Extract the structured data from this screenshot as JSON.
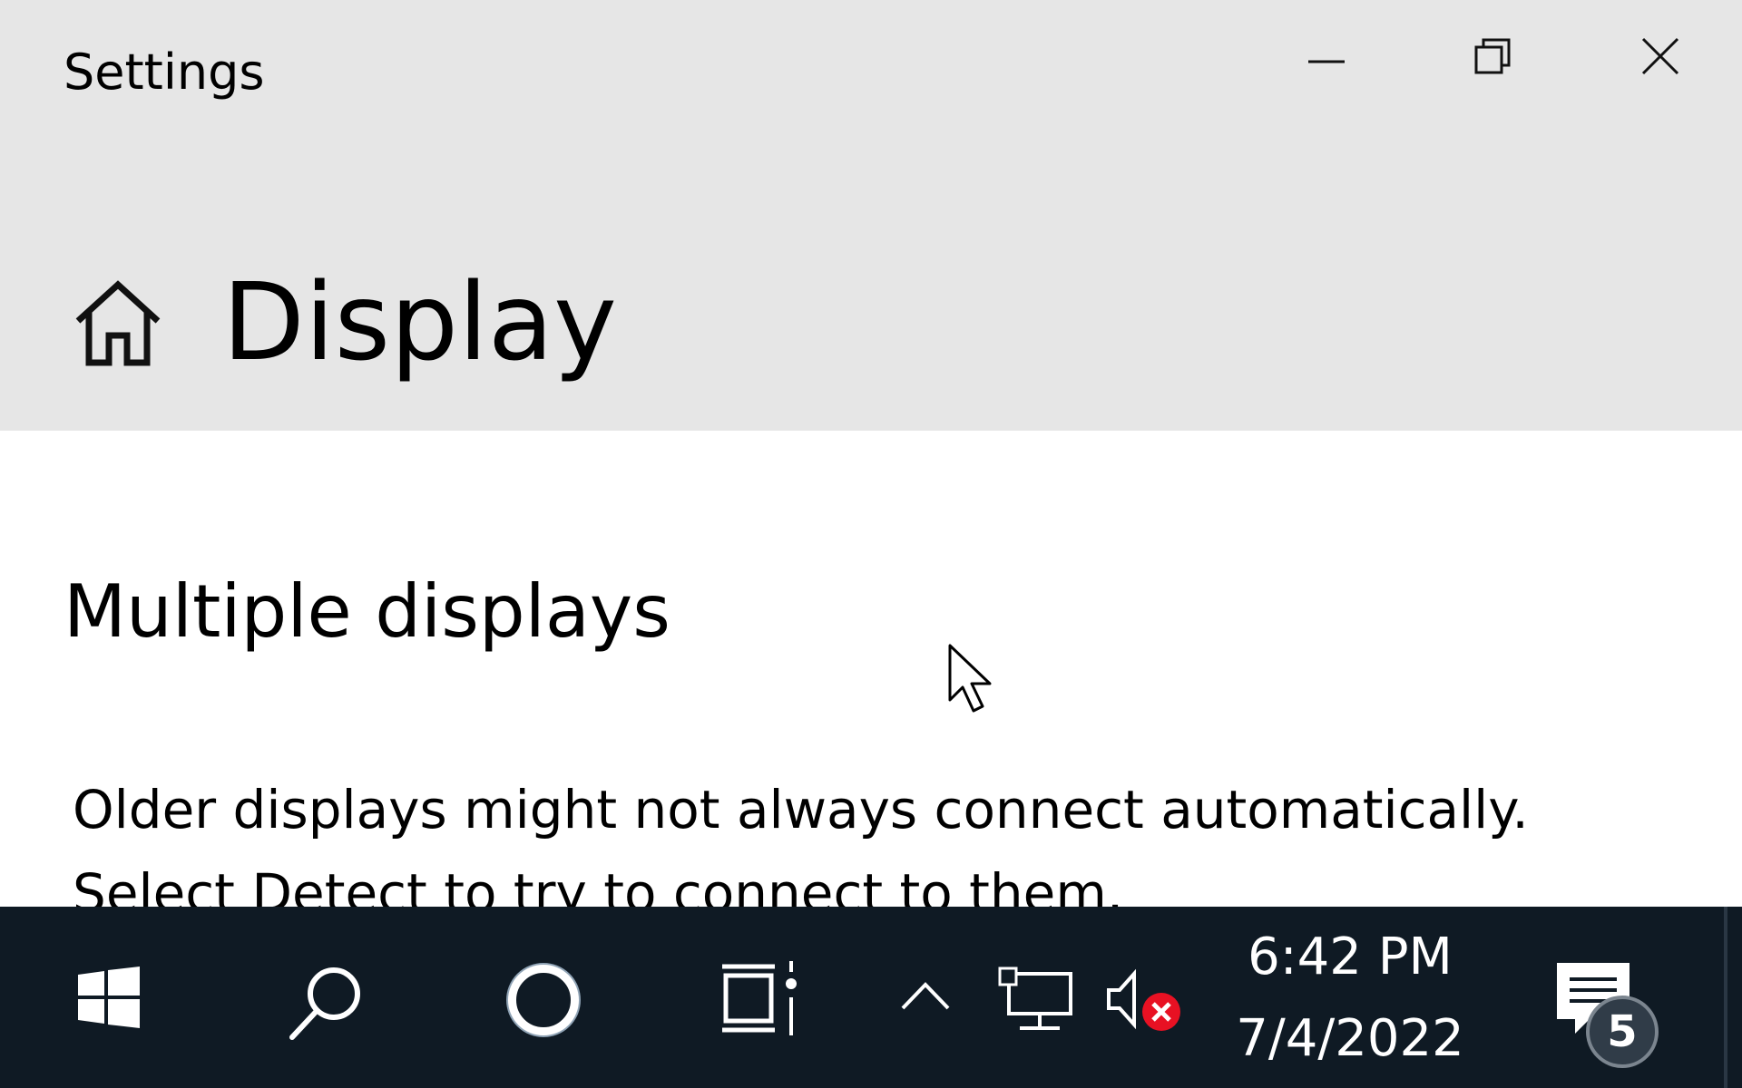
{
  "window": {
    "title": "Settings",
    "controls": [
      "minimize",
      "restore",
      "close"
    ]
  },
  "header": {
    "home_icon": "home-icon",
    "title": "Display"
  },
  "content": {
    "section_heading": "Multiple displays",
    "description": "Older displays might not always connect automatically. Select Detect to try to connect to them."
  },
  "taskbar": {
    "icons": [
      "windows-start-icon",
      "search-icon",
      "cortana-icon",
      "task-view-icon",
      "chevron-up-icon",
      "network-icon",
      "volume-muted-icon",
      "action-center-icon"
    ],
    "clock": {
      "time": "6:42 PM",
      "date": "7/4/2022"
    },
    "notification_count": "5",
    "colors": {
      "background": "#0f1a24",
      "mute_badge": "#e81123"
    }
  }
}
